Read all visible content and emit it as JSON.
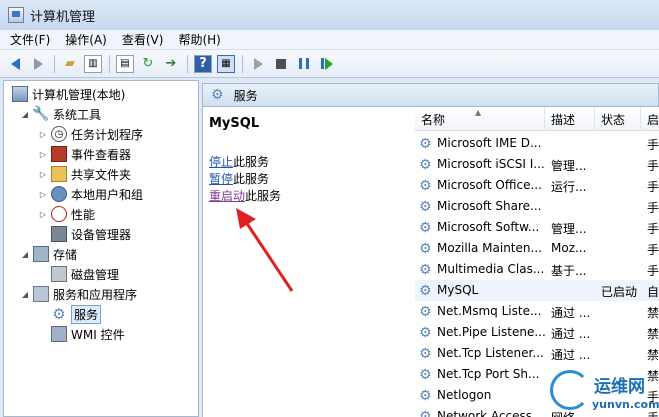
{
  "window": {
    "title": "计算机管理"
  },
  "menu": [
    "文件(F)",
    "操作(A)",
    "查看(V)",
    "帮助(H)"
  ],
  "toolbar_icons": [
    "back-arrow-icon",
    "forward-arrow-icon",
    "up-folder-icon",
    "show-tree-icon",
    "export-icon",
    "refresh-icon",
    "export-list-icon",
    "help-icon",
    "show-action-pane-icon",
    "start-service-icon",
    "stop-service-icon",
    "pause-service-icon",
    "restart-service-icon"
  ],
  "tree": {
    "root": "计算机管理(本地)",
    "system_tools": "系统工具",
    "task_scheduler": "任务计划程序",
    "event_viewer": "事件查看器",
    "shared_folders": "共享文件夹",
    "local_users": "本地用户和组",
    "performance": "性能",
    "device_manager": "设备管理器",
    "storage": "存储",
    "disk_management": "磁盘管理",
    "services_apps": "服务和应用程序",
    "services": "服务",
    "wmi": "WMI 控件"
  },
  "header": {
    "title": "服务"
  },
  "action": {
    "service_name": "MySQL",
    "stop_link": "停止",
    "stop_suffix": "此服务",
    "pause_link": "暂停",
    "pause_suffix": "此服务",
    "restart_link": "重启动",
    "restart_suffix": "此服务"
  },
  "columns": {
    "name": "名称",
    "desc": "描述",
    "status": "状态",
    "start": "启"
  },
  "services": [
    {
      "name": "Microsoft IME D...",
      "desc": "",
      "status": "",
      "start": "手"
    },
    {
      "name": "Microsoft iSCSI I...",
      "desc": "管理...",
      "status": "",
      "start": "手"
    },
    {
      "name": "Microsoft Office...",
      "desc": "运行...",
      "status": "",
      "start": "手"
    },
    {
      "name": "Microsoft Share...",
      "desc": "",
      "status": "",
      "start": "手"
    },
    {
      "name": "Microsoft Softw...",
      "desc": "管理...",
      "status": "",
      "start": "手"
    },
    {
      "name": "Mozilla Mainten...",
      "desc": "Moz...",
      "status": "",
      "start": "手"
    },
    {
      "name": "Multimedia Clas...",
      "desc": "基于...",
      "status": "",
      "start": "手"
    },
    {
      "name": "MySQL",
      "desc": "",
      "status": "已启动",
      "start": "自"
    },
    {
      "name": "Net.Msmq Liste...",
      "desc": "通过 ...",
      "status": "",
      "start": "禁"
    },
    {
      "name": "Net.Pipe Listene...",
      "desc": "通过 ...",
      "status": "",
      "start": "禁"
    },
    {
      "name": "Net.Tcp Listener...",
      "desc": "通过 ...",
      "status": "",
      "start": "禁"
    },
    {
      "name": "Net.Tcp Port Sh...",
      "desc": "",
      "status": "",
      "start": "禁"
    },
    {
      "name": "Netlogon",
      "desc": "",
      "status": "",
      "start": "手"
    },
    {
      "name": "Network Access ...",
      "desc": "网络...",
      "status": "",
      "start": "手"
    }
  ],
  "watermark": {
    "name": "运维网",
    "url": "yunvn.com"
  },
  "colors": {
    "link": "#1e55b3",
    "visited_link": "#7a3a96",
    "annotation_arrow": "#e02020",
    "header_bg": "#cfdff1"
  }
}
